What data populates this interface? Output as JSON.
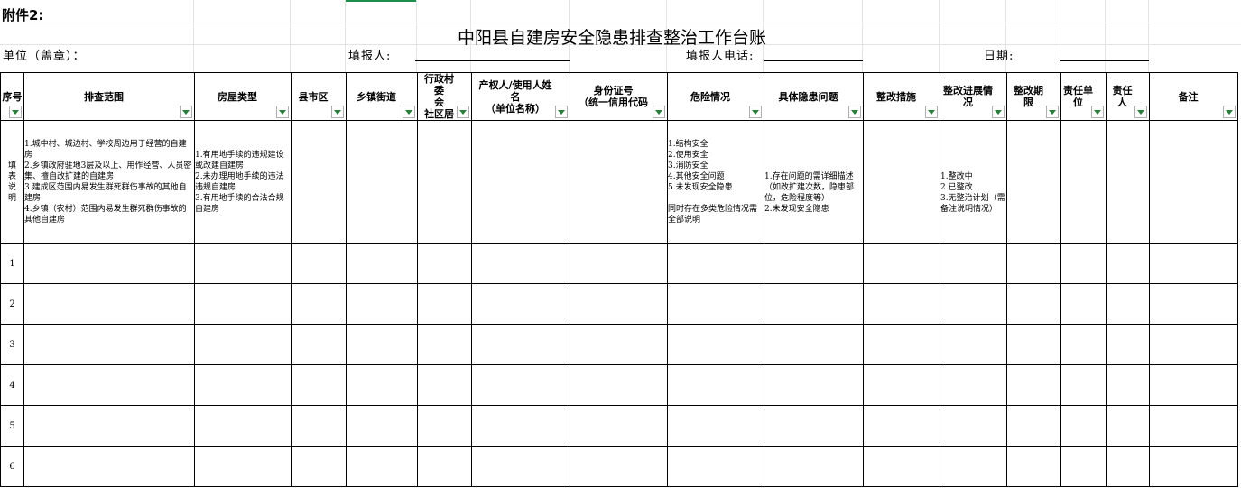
{
  "attachment_label": "附件2:",
  "title": "中阳县自建房安全隐患排查整治工作台账",
  "meta": {
    "unit_label": "单位（盖章）：",
    "filler_label": "填报人:",
    "phone_label": "填报人电话:",
    "date_label": "日期:"
  },
  "columns": [
    {
      "key": "seq",
      "label": "序号"
    },
    {
      "key": "scope",
      "label": "排查范围"
    },
    {
      "key": "house_type",
      "label": "房屋类型"
    },
    {
      "key": "county",
      "label": "县市区"
    },
    {
      "key": "town",
      "label": "乡镇街道"
    },
    {
      "key": "village",
      "label": "行政村委\n会\n社区居"
    },
    {
      "key": "owner",
      "label": "产权人/使用人姓名\n（单位名称）"
    },
    {
      "key": "id",
      "label": "身份证号\n（统一信用代码"
    },
    {
      "key": "danger",
      "label": "危险情况"
    },
    {
      "key": "hazard",
      "label": "具体隐患问题"
    },
    {
      "key": "measure",
      "label": "整改措施"
    },
    {
      "key": "progress",
      "label": "整改进展情况"
    },
    {
      "key": "deadline",
      "label": "整改期限"
    },
    {
      "key": "resp_unit",
      "label": "责任单位"
    },
    {
      "key": "resp_person",
      "label": "责任人"
    },
    {
      "key": "remark",
      "label": "备注"
    }
  ],
  "instructions": {
    "seq": "填表说明",
    "scope": "1.城中村、城边村、学校周边用于经营的自建房\n2.乡镇政府驻地3层及以上、用作经营、人员密集、擅自改扩建的自建房\n3.建成区范围内易发生群死群伤事故的其他自建房\n4.乡镇（农村）范围内易发生群死群伤事故的其他自建房",
    "house_type": "1.有用地手续的违规建设或改建自建房\n2.未办理用地手续的违法违规自建房\n3.有用地手续的合法合规自建房",
    "danger": "1.结构安全\n2.使用安全\n3.消防安全\n4.其他安全问题\n5.未发现安全隐患\n\n同时存在多类危险情况需全部说明",
    "hazard": "\n\n1.存在问题的需详细描述（如改扩建次数，隐患部位，危险程度等）\n2.未发现安全隐患",
    "progress": "\n\n1.整改中\n2.已整改\n3.无整治计划（需备注说明情况）"
  },
  "rows": [
    "1",
    "2",
    "3",
    "4",
    "5",
    "6"
  ]
}
